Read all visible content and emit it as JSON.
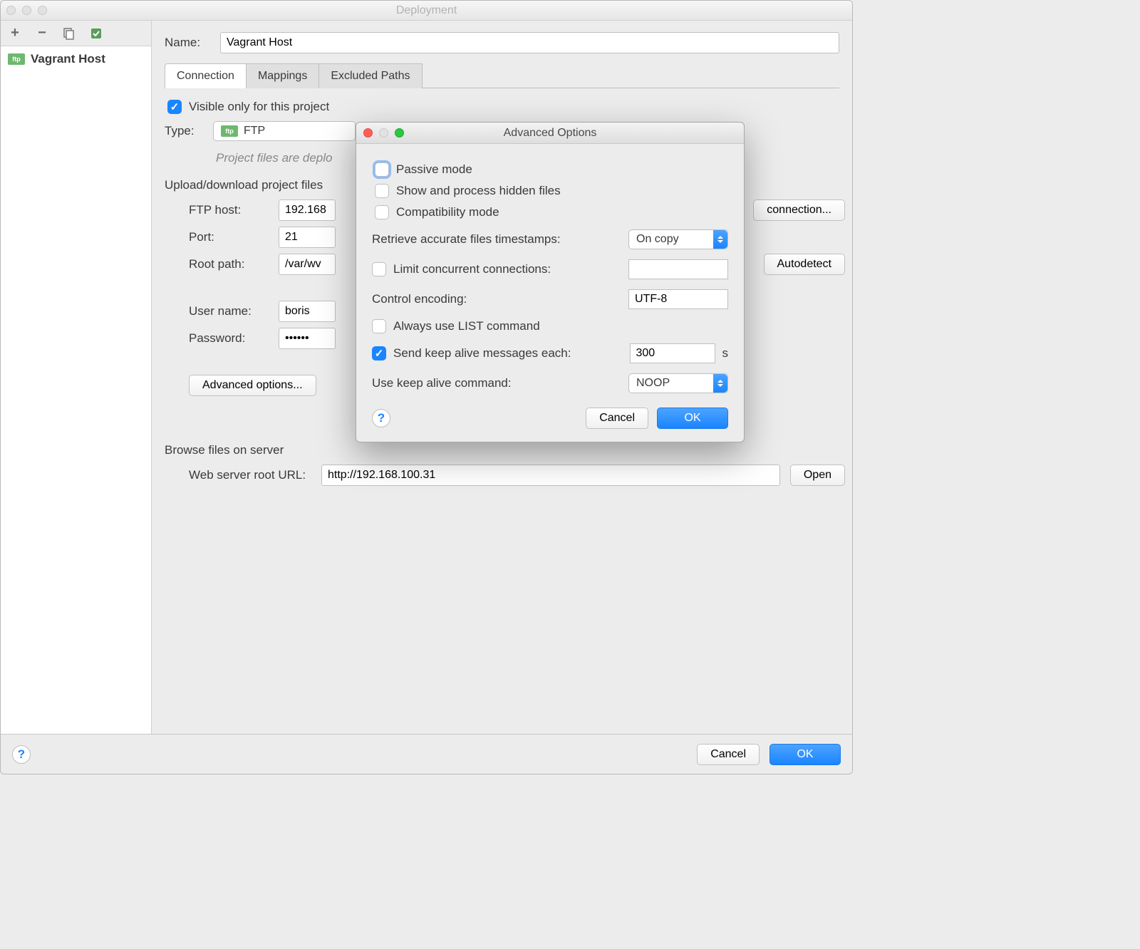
{
  "window": {
    "title": "Deployment",
    "sidebar": {
      "item_label": "Vagrant Host"
    },
    "name_label": "Name:",
    "name_value": "Vagrant Host",
    "tabs": {
      "connection": "Connection",
      "mappings": "Mappings",
      "excluded": "Excluded Paths"
    },
    "visible_only": "Visible only for this project",
    "type_label": "Type:",
    "type_value": "FTP",
    "hint": "Project files are deplo",
    "section_upload": "Upload/download project files",
    "ftp_host_label": "FTP host:",
    "ftp_host_value": "192.168",
    "port_label": "Port:",
    "port_value": "21",
    "root_label": "Root path:",
    "root_value": "/var/wv",
    "user_label": "User name:",
    "user_value": "boris",
    "pass_label": "Password:",
    "pass_value": "••••••",
    "advanced_label": "Advanced options...",
    "test_connection": "connection...",
    "autodetect": "Autodetect",
    "section_browse": "Browse files on server",
    "web_url_label": "Web server root URL:",
    "web_url_value": "http://192.168.100.31",
    "open_btn": "Open",
    "cancel": "Cancel",
    "ok": "OK"
  },
  "dialog": {
    "title": "Advanced Options",
    "passive": "Passive mode",
    "hidden": "Show and process hidden files",
    "compat": "Compatibility mode",
    "retrieve_label": "Retrieve accurate files timestamps:",
    "retrieve_value": "On copy",
    "limit_label": "Limit concurrent connections:",
    "limit_value": "",
    "encoding_label": "Control encoding:",
    "encoding_value": "UTF-8",
    "list_label": "Always use LIST command",
    "keepalive_label": "Send keep alive messages each:",
    "keepalive_value": "300",
    "keepalive_unit": "s",
    "keepalive_cmd_label": "Use keep alive command:",
    "keepalive_cmd_value": "NOOP",
    "cancel": "Cancel",
    "ok": "OK"
  }
}
